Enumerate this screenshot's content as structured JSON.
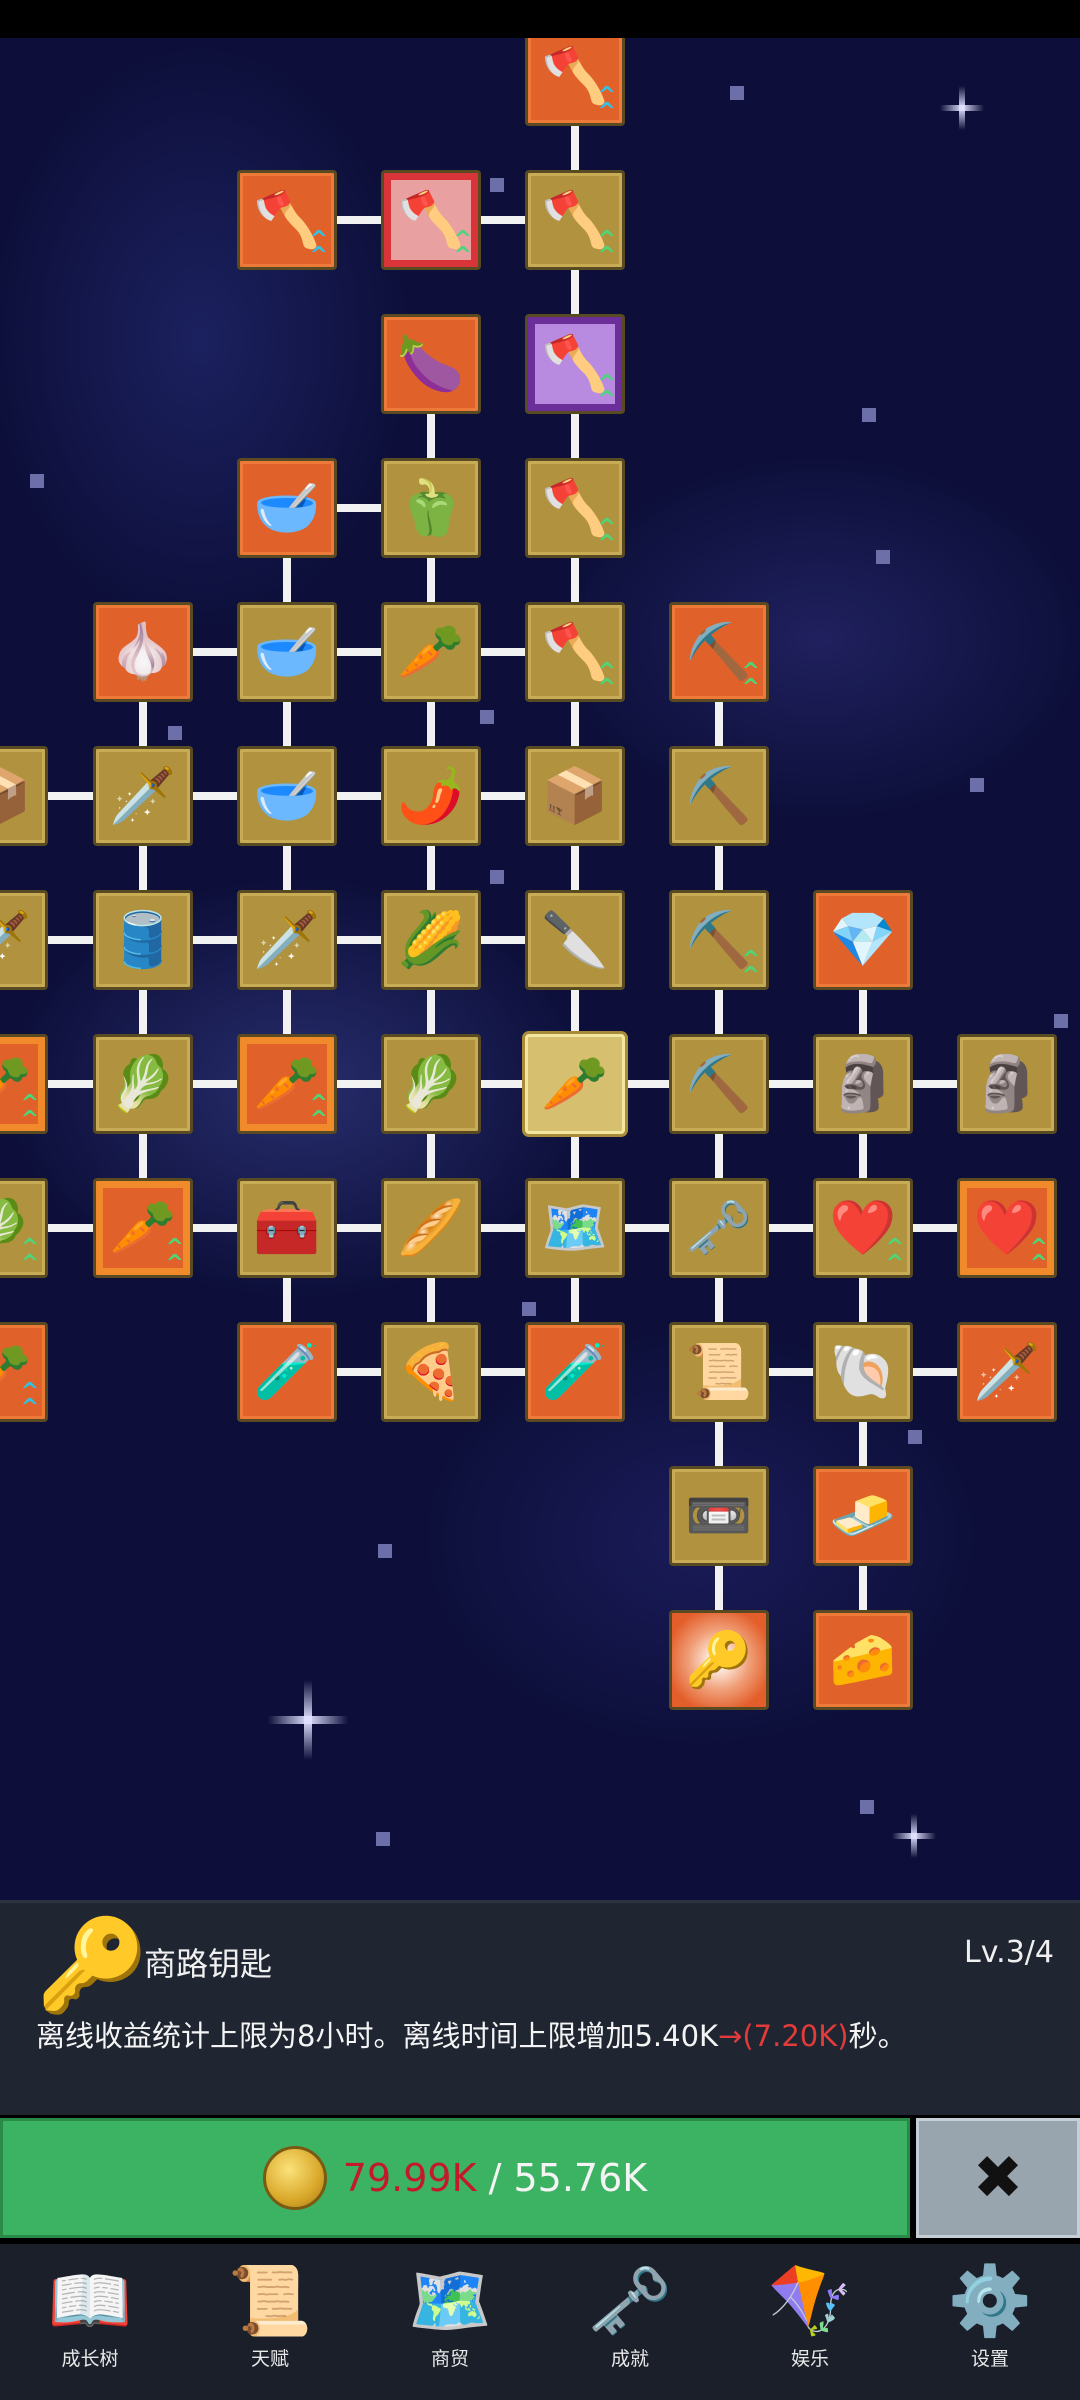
{
  "skill_tree": {
    "nodes": [
      {
        "name": "shovel",
        "icon": "🪓",
        "style": "orange",
        "arrows": "blue"
      },
      {
        "name": "shovel",
        "icon": "🪓",
        "style": "orange",
        "arrows": "blue"
      },
      {
        "name": "shovel",
        "icon": "🪓",
        "style": "frame-red",
        "arrows": "green"
      },
      {
        "name": "shovel",
        "icon": "🪓",
        "style": "gold",
        "arrows": "green"
      },
      {
        "name": "eggplant",
        "icon": "🍆",
        "style": "orange",
        "arrows": ""
      },
      {
        "name": "shovel",
        "icon": "🪓",
        "style": "frame-purple",
        "arrows": "green"
      },
      {
        "name": "bowl",
        "icon": "🥣",
        "style": "orange",
        "arrows": ""
      },
      {
        "name": "pepper",
        "icon": "🫑",
        "style": "gold",
        "arrows": ""
      },
      {
        "name": "shovel",
        "icon": "🪓",
        "style": "gold",
        "arrows": "green"
      },
      {
        "name": "garlic",
        "icon": "🧄",
        "style": "orange",
        "arrows": ""
      },
      {
        "name": "bowl",
        "icon": "🥣",
        "style": "gold",
        "arrows": ""
      },
      {
        "name": "radish",
        "icon": "🥕",
        "style": "gold",
        "arrows": ""
      },
      {
        "name": "shovel",
        "icon": "🪓",
        "style": "gold",
        "arrows": "green"
      },
      {
        "name": "pickaxe",
        "icon": "⛏️",
        "style": "orange",
        "arrows": "green"
      },
      {
        "name": "crate",
        "icon": "📦",
        "style": "gold",
        "arrows": ""
      },
      {
        "name": "sword",
        "icon": "🗡️",
        "style": "gold",
        "arrows": ""
      },
      {
        "name": "bowl",
        "icon": "🥣",
        "style": "gold",
        "arrows": ""
      },
      {
        "name": "chili",
        "icon": "🌶️",
        "style": "gold",
        "arrows": ""
      },
      {
        "name": "crate",
        "icon": "📦",
        "style": "gold",
        "arrows": ""
      },
      {
        "name": "pickaxe",
        "icon": "⛏️",
        "style": "gold",
        "arrows": ""
      },
      {
        "name": "sword",
        "icon": "🗡️",
        "style": "gold",
        "arrows": ""
      },
      {
        "name": "barrel",
        "icon": "🛢️",
        "style": "gold",
        "arrows": ""
      },
      {
        "name": "sword",
        "icon": "🗡️",
        "style": "gold",
        "arrows": ""
      },
      {
        "name": "corn",
        "icon": "🌽",
        "style": "gold",
        "arrows": ""
      },
      {
        "name": "dagger",
        "icon": "🔪",
        "style": "gold",
        "arrows": ""
      },
      {
        "name": "pickaxe",
        "icon": "⛏️",
        "style": "gold",
        "arrows": "green"
      },
      {
        "name": "crystal",
        "icon": "💎",
        "style": "orange",
        "arrows": ""
      },
      {
        "name": "carrot",
        "icon": "🥕",
        "style": "frame-orange",
        "arrows": "green"
      },
      {
        "name": "cabbage",
        "icon": "🥬",
        "style": "gold",
        "arrows": ""
      },
      {
        "name": "carrot",
        "icon": "🥕",
        "style": "frame-orange",
        "arrows": "green"
      },
      {
        "name": "cabbage",
        "icon": "🥬",
        "style": "gold",
        "arrows": ""
      },
      {
        "name": "carrot",
        "icon": "🥕",
        "style": "sel",
        "arrows": ""
      },
      {
        "name": "pickaxe",
        "icon": "⛏️",
        "style": "gold",
        "arrows": ""
      },
      {
        "name": "statue",
        "icon": "🗿",
        "style": "gold",
        "arrows": ""
      },
      {
        "name": "statue",
        "icon": "🗿",
        "style": "gold",
        "arrows": ""
      },
      {
        "name": "cabbage",
        "icon": "🥬",
        "style": "gold",
        "arrows": "green"
      },
      {
        "name": "carrot",
        "icon": "🥕",
        "style": "frame-orange",
        "arrows": "green"
      },
      {
        "name": "chest",
        "icon": "🧰",
        "style": "gold",
        "arrows": ""
      },
      {
        "name": "parsnip",
        "icon": "🥖",
        "style": "gold",
        "arrows": ""
      },
      {
        "name": "map",
        "icon": "🗺️",
        "style": "gold",
        "arrows": ""
      },
      {
        "name": "golden-key",
        "icon": "🗝️",
        "style": "gold",
        "arrows": ""
      },
      {
        "name": "heart",
        "icon": "❤️",
        "style": "gold",
        "arrows": "green"
      },
      {
        "name": "heart",
        "icon": "❤️",
        "style": "frame-orange",
        "arrows": "green"
      },
      {
        "name": "carrot",
        "icon": "🥕",
        "style": "orange",
        "arrows": "blue"
      },
      {
        "name": "potion",
        "icon": "🧪",
        "style": "orange",
        "arrows": ""
      },
      {
        "name": "pizza",
        "icon": "🍕",
        "style": "gold",
        "arrows": ""
      },
      {
        "name": "potion",
        "icon": "🧪",
        "style": "orange",
        "arrows": ""
      },
      {
        "name": "scroll",
        "icon": "📜",
        "style": "gold",
        "arrows": ""
      },
      {
        "name": "fossil",
        "icon": "🐚",
        "style": "gold",
        "arrows": ""
      },
      {
        "name": "sword",
        "icon": "🗡️",
        "style": "orange",
        "arrows": ""
      },
      {
        "name": "cassette",
        "icon": "📼",
        "style": "gold",
        "arrows": ""
      },
      {
        "name": "butter",
        "icon": "🧈",
        "style": "orange",
        "arrows": ""
      },
      {
        "name": "silver-key",
        "icon": "🔑",
        "style": "burst",
        "arrows": ""
      },
      {
        "name": "cheese",
        "icon": "🧀",
        "style": "orange",
        "arrows": ""
      }
    ]
  },
  "detail": {
    "key_icon": "🔑",
    "name": "商路钥匙",
    "level": "Lv.3/4",
    "desc_prefix": "离线收益统计上限为8小时。离线时间上限增加5.40K",
    "desc_arrow": "→",
    "desc_highlight": "(7.20K)",
    "desc_suffix": "秒。"
  },
  "upgrade": {
    "have": "79.99K",
    "separator": " / ",
    "cost": "55.76K",
    "close_symbol": "✖"
  },
  "nav": [
    {
      "icon": "📖",
      "label": "成长树"
    },
    {
      "icon": "📜",
      "label": "天赋"
    },
    {
      "icon": "🗺️",
      "label": "商贸"
    },
    {
      "icon": "🗝️",
      "label": "成就"
    },
    {
      "icon": "🪁",
      "label": "娱乐"
    },
    {
      "icon": "⚙️",
      "label": "设置"
    }
  ],
  "colors": {
    "gold_tile": "#b0923f",
    "orange_tile": "#e0622a",
    "accent_green": "#3cb263",
    "highlight_red": "#e33a3a"
  }
}
